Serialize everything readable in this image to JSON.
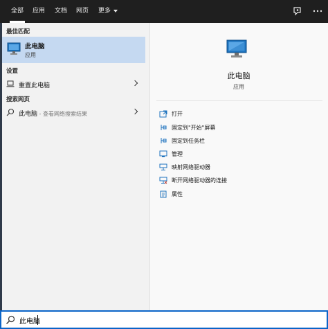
{
  "tabs": [
    "全部",
    "应用",
    "文档",
    "网页",
    "更多"
  ],
  "best_match": {
    "heading": "最佳匹配",
    "title": "此电脑",
    "subtitle": "应用"
  },
  "settings": {
    "heading": "设置",
    "item": "重置此电脑"
  },
  "web": {
    "heading": "搜索网页",
    "item": "此电脑",
    "suffix": " - 查看网络搜索结果"
  },
  "preview": {
    "title": "此电脑",
    "subtitle": "应用"
  },
  "actions": [
    {
      "label": "打开",
      "icon": "open-icon"
    },
    {
      "label": "固定到\"开始\"屏幕",
      "icon": "pin-start-icon"
    },
    {
      "label": "固定到任务栏",
      "icon": "pin-taskbar-icon"
    },
    {
      "label": "管理",
      "icon": "manage-icon"
    },
    {
      "label": "映射网络驱动器",
      "icon": "map-drive-icon"
    },
    {
      "label": "断开网络驱动器的连接",
      "icon": "disconnect-drive-icon"
    },
    {
      "label": "属性",
      "icon": "properties-icon"
    }
  ],
  "search": {
    "value": "此电脑"
  },
  "colors": {
    "accent": "#0a64c8",
    "selected": "#c5d9f1",
    "icon_blue": "#1e73be"
  }
}
